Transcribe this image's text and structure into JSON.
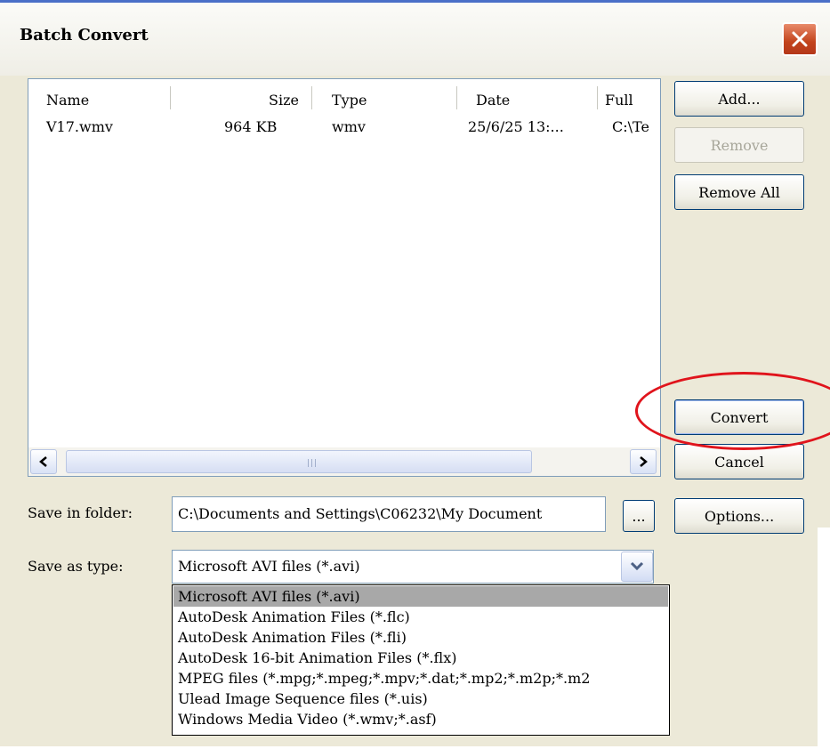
{
  "window": {
    "title": "Batch Convert"
  },
  "file_list": {
    "columns": [
      "Name",
      "Size",
      "Type",
      "Date",
      "Full"
    ],
    "rows": [
      {
        "name": "V17.wmv",
        "size": "964 KB",
        "type": "wmv",
        "date": "25/6/25 13:...",
        "full": "C:\\Te"
      }
    ]
  },
  "buttons": {
    "add": "Add...",
    "remove": "Remove",
    "remove_all": "Remove All",
    "convert": "Convert",
    "cancel": "Cancel",
    "browse": "...",
    "options": "Options..."
  },
  "save_in_folder": {
    "label": "Save in folder:",
    "value": "C:\\Documents and Settings\\C06232\\My Document"
  },
  "save_as_type": {
    "label": "Save as type:",
    "selected": "Microsoft AVI files (*.avi)",
    "options": [
      "Microsoft AVI files (*.avi)",
      "AutoDesk Animation Files (*.flc)",
      "AutoDesk Animation Files (*.fli)",
      "AutoDesk 16-bit Animation Files (*.flx)",
      "MPEG files (*.mpg;*.mpeg;*.mpv;*.dat;*.mp2;*.m2p;*.m2",
      "Ulead Image Sequence files (*.uis)",
      "Windows Media Video (*.wmv;*.asf)"
    ]
  },
  "colors": {
    "annotation_circle": "#e0141c",
    "close_button": "#c2431c"
  }
}
